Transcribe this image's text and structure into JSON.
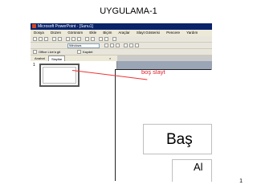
{
  "page": {
    "title": "UYGULAMA-1",
    "page_number": "1"
  },
  "window": {
    "title": "Microsoft PowerPoint - [Sunu1]"
  },
  "menu": [
    "Dosya",
    "Düzen",
    "Görünüm",
    "Ekle",
    "Biçim",
    "Araçlar",
    "Slayt Gösterisi",
    "Pencere",
    "Yardım"
  ],
  "toolbar": {
    "font_name": "Windows",
    "office_live": "Office Live'a git",
    "save_label": "Kaydet"
  },
  "tabs": {
    "outline": "Anahat",
    "slides": "Slaytlar",
    "close": "×"
  },
  "slide_panel": {
    "number": "1"
  },
  "slide": {
    "title_fragment": "Baş",
    "subtitle_fragment": "Al"
  },
  "annotation": {
    "label": "boş slayt",
    "color": "#e0202a"
  }
}
